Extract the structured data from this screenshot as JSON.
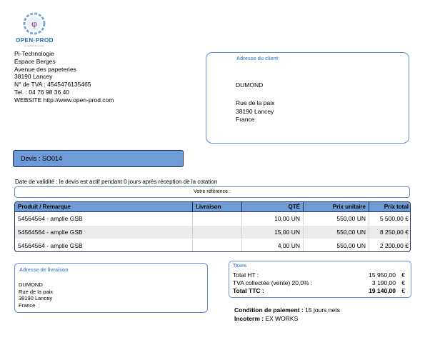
{
  "logo": {
    "text": "OPEN·PROD",
    "subtext": "Le logiciel de gestion"
  },
  "company": {
    "lines": [
      "Pi-Technologie",
      "Espace Berges",
      "Avenue des papeteries",
      "38190 Lancey",
      "N° de TVA : 4545476135465",
      "Tel. : 04 76 98 36 40",
      "WEBSITE http://www.open-prod.com"
    ]
  },
  "client": {
    "title": "Adresse du client",
    "name": "DUMOND",
    "street": "Rue de la paix",
    "city": "38190 Lancey",
    "country": "France"
  },
  "devis": {
    "label": "Devis : SO014"
  },
  "validity": "Date de validité : le devis est actif pendant 0 jours après réception de la cotation",
  "reference": {
    "label": "Votre référence :"
  },
  "table": {
    "headers": [
      "Produit / Remarque",
      "Livraison",
      "QTÉ",
      "Prix unitaire",
      "Prix total"
    ],
    "rows": [
      {
        "product": "54564564 - amplie GSB",
        "delivery": "",
        "qty": "10,00 UN",
        "unit_price": "550,00 UN",
        "total": "5 500,00 €"
      },
      {
        "product": "54564564 - amplie GSB",
        "delivery": "",
        "qty": "15,00 UN",
        "unit_price": "550,00 UN",
        "total": "8 250,00 €"
      },
      {
        "product": "54564564 - amplie GSB",
        "delivery": "",
        "qty": "4,00 UN",
        "unit_price": "550,00 UN",
        "total": "2 200,00 €"
      }
    ]
  },
  "delivery": {
    "title": "Adresse de livraison",
    "name": "DUMOND",
    "street": "Rue de la paix",
    "city": "38190 Lancey",
    "country": "France"
  },
  "taxes": {
    "title": "Taxes",
    "total_ht_label": "Total HT :",
    "total_ht_value": "15 950,00",
    "tva_label": "TVA collectée (vente) 20,0% :",
    "tva_value": "3 190,00",
    "total_ttc_label": "Total TTC :",
    "total_ttc_value": "19 140,00",
    "currency": "€"
  },
  "conditions": {
    "payment_label": "Condition de paiement :",
    "payment_value": " 15 jours nets",
    "incoterm_label": "Incoterm :",
    "incoterm_value": " EX WORKS"
  },
  "colors": {
    "accent": "#6f9bd6",
    "border": "#5b8fd0",
    "dark": "#1f3150",
    "row_alt": "#ececec"
  }
}
